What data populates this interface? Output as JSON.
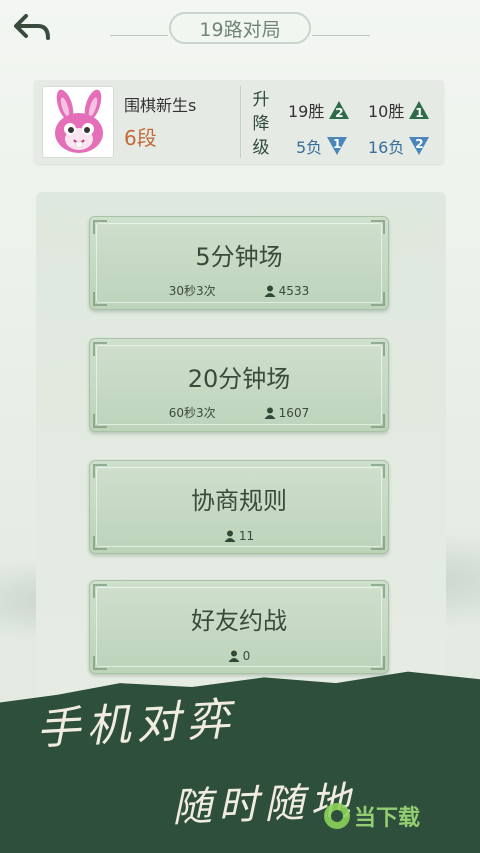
{
  "header": {
    "title": "19路对局"
  },
  "profile": {
    "name": "围棋新生s",
    "rank": "6段",
    "updown_label": [
      "升",
      "降",
      "级"
    ],
    "stats": [
      {
        "text": "19胜",
        "badge": "2",
        "dir": "up"
      },
      {
        "text": "10胜",
        "badge": "1",
        "dir": "up"
      },
      {
        "text": "5负",
        "badge": "1",
        "dir": "down"
      },
      {
        "text": "16负",
        "badge": "2",
        "dir": "down"
      }
    ]
  },
  "modes": [
    {
      "label": "5分钟场",
      "rule": "30秒3次",
      "players": "4533"
    },
    {
      "label": "20分钟场",
      "rule": "60秒3次",
      "players": "1607"
    },
    {
      "label": "协商规则",
      "rule": "",
      "players": "11"
    },
    {
      "label": "好友约战",
      "rule": "",
      "players": "0"
    }
  ],
  "banner": {
    "line1": "手机对弈",
    "line2": "随时随地"
  },
  "watermark": {
    "text": "当下载"
  },
  "colors": {
    "up": "#2e6b48",
    "down": "#4a86b8",
    "rank": "#c06a3a",
    "banner": "#2e4f3c"
  }
}
